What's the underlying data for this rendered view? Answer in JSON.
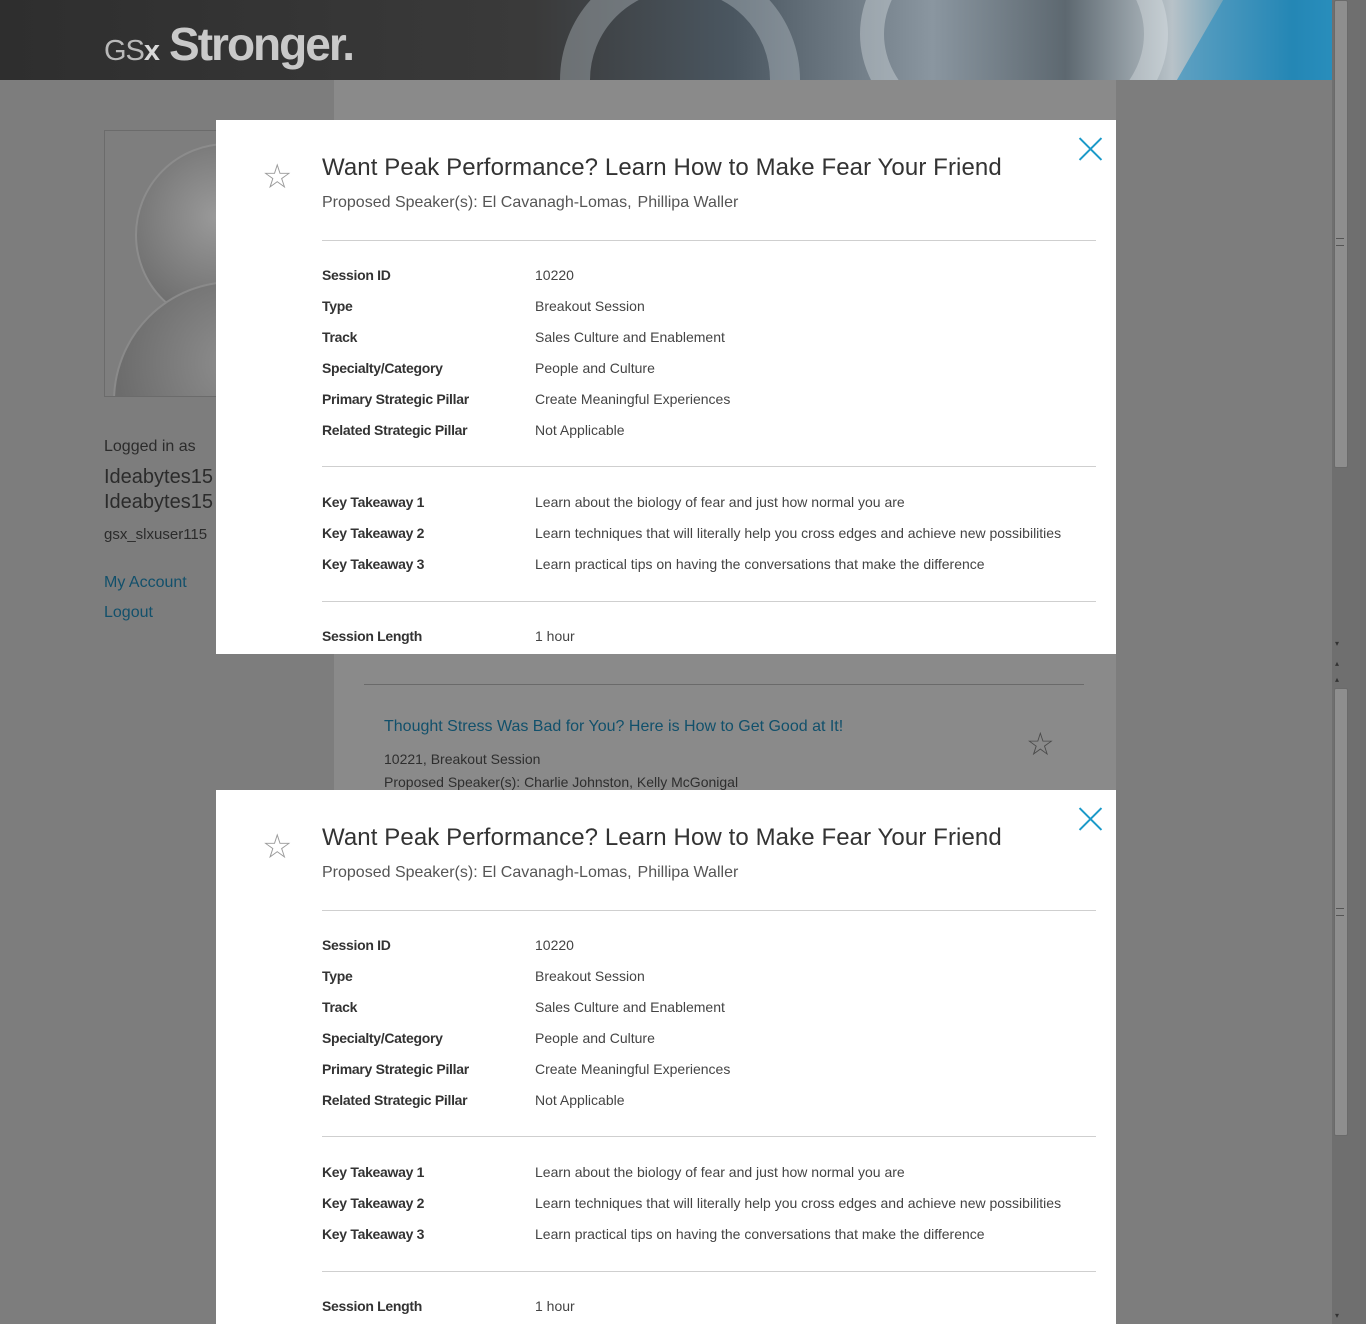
{
  "header": {
    "logo_gs": "GS",
    "logo_x": "x",
    "logo_tagline": "Stronger."
  },
  "sidebar": {
    "logged_in_label": "Logged in as",
    "user_first": "Ideabytes15",
    "user_last": "Ideabytes15",
    "username": "gsx_slxuser115",
    "my_account": "My Account",
    "logout": "Logout"
  },
  "background_list": {
    "session_title": "Thought Stress Was Bad for You? Here is How to Get Good at It!",
    "session_meta": "10221, Breakout Session",
    "session_speakers": "Proposed Speaker(s): Charlie Johnston,  Kelly McGonigal"
  },
  "modal": {
    "title": "Want Peak Performance? Learn How to Make Fear Your Friend",
    "speakers_prefix": "Proposed Speaker(s):",
    "speaker_1": "El Cavanagh-Lomas,",
    "speaker_2": "Phillipa Waller",
    "details": [
      {
        "label": "Session ID",
        "value": "10220"
      },
      {
        "label": "Type",
        "value": "Breakout Session"
      },
      {
        "label": "Track",
        "value": "Sales Culture and Enablement"
      },
      {
        "label": "Specialty/Category",
        "value": "People and Culture"
      },
      {
        "label": "Primary Strategic Pillar",
        "value": "Create Meaningful Experiences"
      },
      {
        "label": "Related Strategic Pillar",
        "value": "Not Applicable"
      }
    ],
    "takeaways": [
      {
        "label": "Key Takeaway 1",
        "value": "Learn about the biology of fear and just how normal you are"
      },
      {
        "label": "Key Takeaway 2",
        "value": "Learn techniques that will literally help you cross edges and achieve new possibilities"
      },
      {
        "label": "Key Takeaway 3",
        "value": "Learn practical tips on having the conversations that make the difference"
      }
    ],
    "length_label": "Session Length",
    "length_value": "1 hour"
  },
  "icons": {
    "favorite": "star-outline-icon",
    "close": "close-icon"
  },
  "colors": {
    "accent": "#1b9ac9",
    "link": "#12506b",
    "overlay": "#7d7d7d"
  }
}
